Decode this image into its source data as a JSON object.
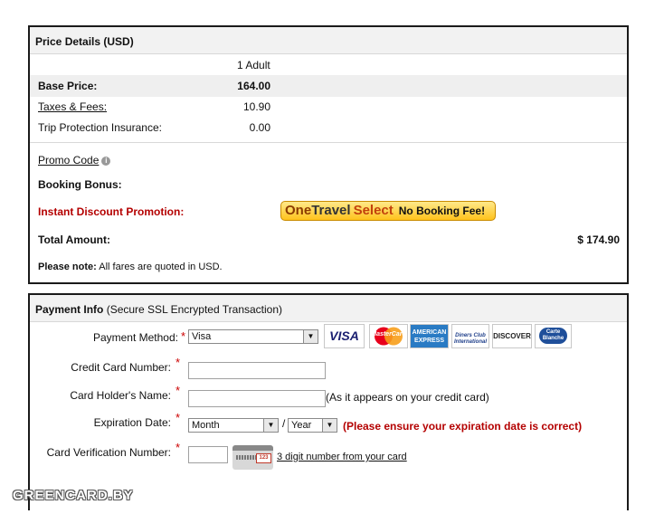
{
  "price_details": {
    "header": "Price Details (USD)",
    "passenger_column": "1 Adult",
    "rows": [
      {
        "label": "Base Price:",
        "value": "164.00"
      },
      {
        "label": "Taxes & Fees:",
        "value": "10.90"
      },
      {
        "label": "Trip Protection Insurance:",
        "value": "0.00"
      }
    ],
    "promo_code": "Promo Code",
    "booking_bonus": "Booking Bonus:",
    "instant_discount": "Instant Discount Promotion:",
    "badge": {
      "one": "One",
      "travel": "Travel",
      "select": "Select",
      "fee": "No Booking Fee!"
    },
    "total_label": "Total Amount:",
    "total_value": "$ 174.90",
    "note_label": "Please note:",
    "note_text": "All fares are quoted in USD."
  },
  "payment_info": {
    "header": "Payment Info",
    "header_sub": "(Secure SSL Encrypted Transaction)",
    "payment_method_label": "Payment Method:",
    "payment_method_value": "Visa",
    "card_logos": [
      "VISA",
      "MasterCard",
      "AMERICAN EXPRESS",
      "Diners Club International",
      "DISCOVER",
      "Carte Blanche"
    ],
    "credit_card_label": "Credit Card Number:",
    "credit_card_value": "",
    "holder_label": "Card Holder's Name:",
    "holder_value": "",
    "holder_hint": "(As it appears on your credit card)",
    "expiration_label": "Expiration Date:",
    "month_value": "Month",
    "year_value": "Year",
    "date_separator": "/",
    "expiration_warning": "(Please ensure your expiration date is correct)",
    "cvv_label": "Card Verification Number:",
    "cvv_value": "",
    "cvv_card_digits": "123",
    "cvv_link": "3 digit number from your card",
    "required_mark": "*"
  },
  "watermark": "GREENCARD.BY",
  "colors": {
    "accent_red": "#b40000",
    "required_red": "#cc0000",
    "badge_gold": "#ffc21c"
  }
}
